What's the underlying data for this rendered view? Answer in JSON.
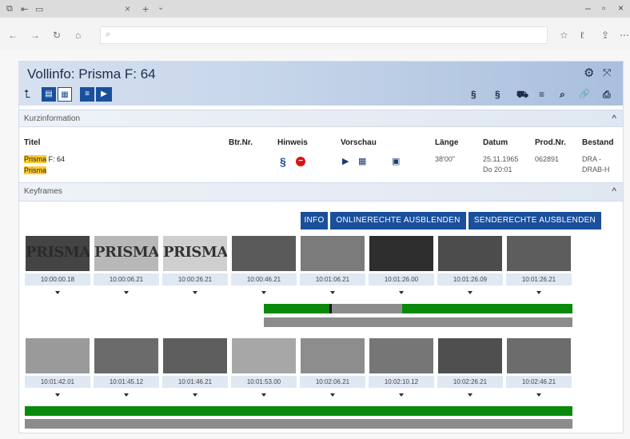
{
  "browser": {
    "tab_close": "×",
    "tab_new": "+",
    "tab_menu": "⌄",
    "win_min": "–",
    "win_max": "▫",
    "win_close": "×",
    "nav_back": "←",
    "nav_forward": "→",
    "nav_refresh": "↻",
    "nav_home": "⌂",
    "url_search_icon": "⌕",
    "url_value": ""
  },
  "app": {
    "title": "Vollinfo: Prisma F: 64",
    "back_icon": "⮤",
    "view_buttons": [
      {
        "name": "document-view-button",
        "glyph": "▤"
      },
      {
        "name": "grid-view-button",
        "glyph": "▦"
      },
      {
        "name": "list-view-button",
        "glyph": "≡"
      },
      {
        "name": "play-button",
        "glyph": "▶"
      }
    ],
    "toolbar_icons": [
      {
        "name": "paragraph-c-icon",
        "glyph": "§"
      },
      {
        "name": "paragraph-e-icon",
        "glyph": "§"
      },
      {
        "name": "cart-icon",
        "glyph": "⛟"
      },
      {
        "name": "list-icon",
        "glyph": "≡"
      },
      {
        "name": "search-icon",
        "glyph": "⌕"
      },
      {
        "name": "link-icon",
        "glyph": "🔗"
      },
      {
        "name": "print-icon",
        "glyph": "⎙"
      }
    ],
    "gear_icon": "⚙",
    "expand_icon": "⤧"
  },
  "kurzinfo": {
    "label": "Kurzinformation",
    "caret": "^",
    "columns": [
      "Titel",
      "Btr.Nr.",
      "Hinweis",
      "Vorschau",
      "Länge",
      "Datum",
      "Prod.Nr.",
      "Bestand"
    ],
    "row": {
      "title_hl": "Prisma",
      "title_rest": " F: 64",
      "subtitle_hl": "Prisma",
      "btr_nr": "",
      "hinweis_symbol": "§",
      "hinweis_stop": "−",
      "vorschau_play": "▶",
      "vorschau_grid": "▦",
      "vorschau_single": "▣",
      "laenge": "38'00\"",
      "datum_line1": "25.11.1965",
      "datum_line2": "Do 20:01",
      "prod_nr": "062891",
      "bestand_line1": "DRA -",
      "bestand_line2": "DRAB-H"
    }
  },
  "keyframes": {
    "label": "Keyframes",
    "caret": "^",
    "buttons": [
      "INFO",
      "ONLINERECHTE AUSBLENDEN",
      "SENDERECHTE AUSBLENDEN"
    ],
    "row1": [
      {
        "tc": "10:00:00.18",
        "overlay": "PRISMA"
      },
      {
        "tc": "10:00:06.21",
        "overlay": "PRISMA"
      },
      {
        "tc": "10:00:26.21",
        "overlay": "PRISMA"
      },
      {
        "tc": "10:00:46.21",
        "overlay": ""
      },
      {
        "tc": "10:01:06.21",
        "overlay": ""
      },
      {
        "tc": "10:01:26.00",
        "overlay": ""
      },
      {
        "tc": "10:01:26.09",
        "overlay": ""
      },
      {
        "tc": "10:01:26.21",
        "overlay": ""
      }
    ],
    "row2": [
      {
        "tc": "10:01:42.01",
        "overlay": ""
      },
      {
        "tc": "10:01:45.12",
        "overlay": ""
      },
      {
        "tc": "10:01:46.21",
        "overlay": ""
      },
      {
        "tc": "10:01:53.00",
        "overlay": ""
      },
      {
        "tc": "10:02:06.21",
        "overlay": ""
      },
      {
        "tc": "10:02:10.12",
        "overlay": ""
      },
      {
        "tc": "10:02:26.21",
        "overlay": ""
      },
      {
        "tc": "10:02:46.21",
        "overlay": ""
      }
    ],
    "colors": {
      "green": "#0a8a0a",
      "gray": "#8c8c8c",
      "marker": "#111111"
    }
  }
}
